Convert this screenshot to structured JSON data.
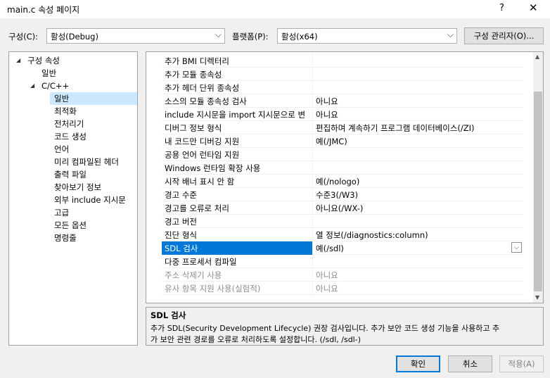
{
  "window": {
    "title": "main.c 속성 페이지",
    "help": "?",
    "close": "✕"
  },
  "config": {
    "label": "구성(C):",
    "value": "활성(Debug)"
  },
  "platform": {
    "label": "플랫폼(P):",
    "value": "활성(x64)"
  },
  "config_manager_label": "구성 관리자(O)...",
  "tree": [
    {
      "label": "구성 속성",
      "arrow": "◢"
    },
    {
      "label": "일반"
    },
    {
      "label": "C/C++",
      "arrow": "◢"
    },
    {
      "label": "일반",
      "selected": true
    },
    {
      "label": "최적화"
    },
    {
      "label": "전처리기"
    },
    {
      "label": "코드 생성"
    },
    {
      "label": "언어"
    },
    {
      "label": "미리 컴파일된 헤더"
    },
    {
      "label": "출력 파일"
    },
    {
      "label": "찾아보기 정보"
    },
    {
      "label": "외부 include 지시문"
    },
    {
      "label": "고급"
    },
    {
      "label": "모든 옵션"
    },
    {
      "label": "명령줄"
    }
  ],
  "grid": [
    {
      "name": "추가 BMI 디렉터리",
      "value": ""
    },
    {
      "name": "추가 모듈 종속성",
      "value": ""
    },
    {
      "name": "추가 헤더 단위 종속성",
      "value": ""
    },
    {
      "name": "소스의 모듈 종속성 검사",
      "value": "아니요"
    },
    {
      "name": "include 지시문을 import 지시문으로 변",
      "value": "아니요"
    },
    {
      "name": "디버그 정보 형식",
      "value": "편집하며 계속하기 프로그램 데이터베이스(/ZI)"
    },
    {
      "name": "내 코드만 디버깅 지원",
      "value": "예(/JMC)"
    },
    {
      "name": "공용 언어 런타임 지원",
      "value": ""
    },
    {
      "name": "Windows 런타임 확장 사용",
      "value": ""
    },
    {
      "name": "시작 배너 표시 안 함",
      "value": "예(/nologo)"
    },
    {
      "name": "경고 수준",
      "value": "수준3(/W3)"
    },
    {
      "name": "경고를 오류로 처리",
      "value": "아니요(/WX-)"
    },
    {
      "name": "경고 버전",
      "value": ""
    },
    {
      "name": "진단 형식",
      "value": "열 정보(/diagnostics:column)"
    },
    {
      "name": "SDL 검사",
      "value": "예(/sdl)",
      "selected": true
    },
    {
      "name": "다중 프로세서 컴파일",
      "value": ""
    },
    {
      "name": "주소 삭제기 사용",
      "value": "아니요",
      "disabled": true
    },
    {
      "name": "유사 항목 지원 사용(실험적)",
      "value": "아니요",
      "disabled": true
    }
  ],
  "description": {
    "title": "SDL 검사",
    "line1": "추가 SDL(Security Development Lifecycle) 권장 검사입니다. 추가 보안 코드 생성 기능을 사용하고 추",
    "line2": "가 보안 관련 경로를 오류로 처리하도록 설정합니다. (/sdl, /sdl-)"
  },
  "buttons": {
    "ok": "확인",
    "cancel": "취소",
    "apply": "적용(A)"
  },
  "icons": {
    "chevron": "chevron-down-icon",
    "tree_expanded": "tree-expanded-icon"
  },
  "colors": {
    "selection": "#0078d7",
    "tree_selection": "#cce8ff",
    "disabled_text": "#8c8c8c"
  }
}
